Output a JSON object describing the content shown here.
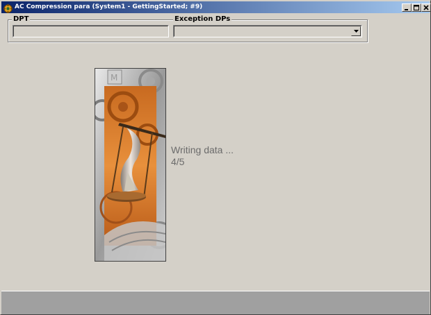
{
  "window": {
    "title": "AC Compression para (System1 - GettingStarted; #9)",
    "buttons": [
      "minimize",
      "maximize",
      "close"
    ]
  },
  "form": {
    "dpt_label": "DPT",
    "dpt_value": "",
    "exception_label": "Exception DPs",
    "exception_value": ""
  },
  "progress": {
    "message": "Writing data ...",
    "step": "4/5"
  },
  "colors": {
    "title_start": "#0a246a",
    "title_end": "#a6caf0",
    "background": "#d4d0c8",
    "splash_accent": "#d9792a"
  },
  "icons": {
    "app": "gear-app-icon",
    "splash": "hourglass-gears-image"
  }
}
